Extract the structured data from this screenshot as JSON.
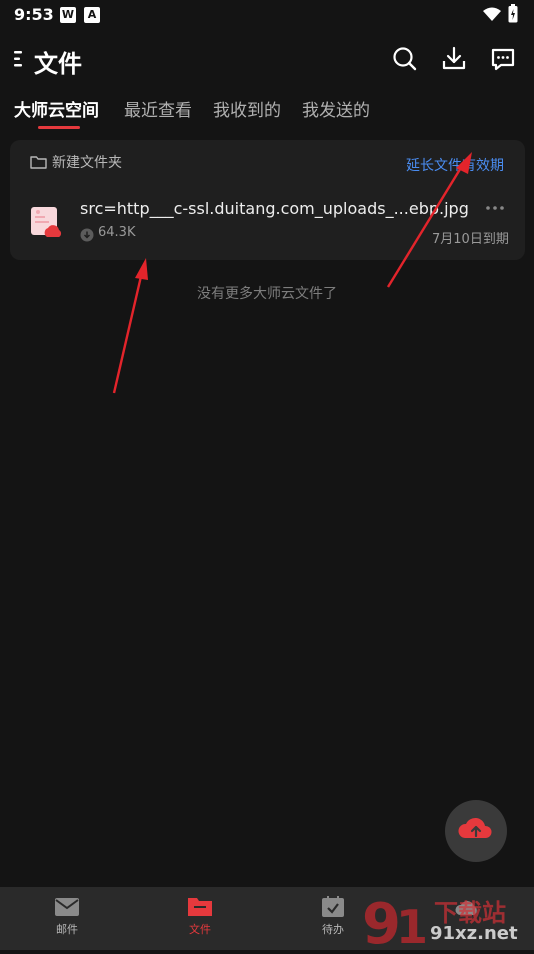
{
  "status_bar": {
    "time": "9:53",
    "app_icon_1": "W",
    "app_icon_2": "A"
  },
  "header": {
    "title": "文件"
  },
  "tabs": [
    {
      "label": "大师云空间",
      "active": true
    },
    {
      "label": "最近查看",
      "active": false
    },
    {
      "label": "我收到的",
      "active": false
    },
    {
      "label": "我发送的",
      "active": false
    }
  ],
  "card": {
    "new_folder_label": "新建文件夹",
    "extend_link": "延长文件有效期",
    "file": {
      "name": "src=http___c-ssl.duitang.com_uploads_...ebp.jpg",
      "size": "64.3K",
      "expiry": "7月10日到期"
    }
  },
  "empty_message": "没有更多大师云文件了",
  "bottom_nav": [
    {
      "label": "邮件",
      "active": false
    },
    {
      "label": "文件",
      "active": true
    },
    {
      "label": "待办",
      "active": false
    },
    {
      "label": "",
      "active": false
    }
  ],
  "watermark": {
    "text": "91xz.net",
    "brand": "下载站"
  },
  "colors": {
    "accent": "#e5393d",
    "link": "#4a8cf0",
    "background": "#141414",
    "card": "#1f1f1f"
  }
}
